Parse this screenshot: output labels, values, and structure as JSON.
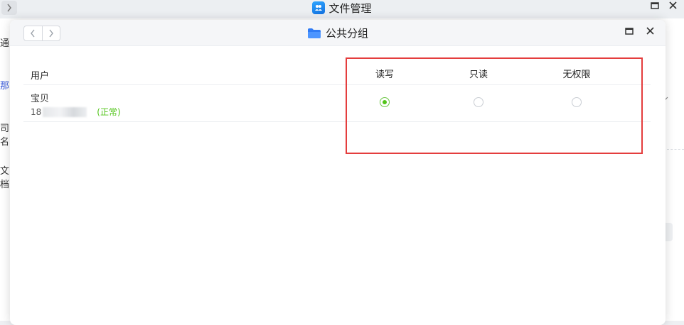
{
  "parent_window": {
    "title": "文件管理",
    "sidebar_fragments": [
      "通",
      "那",
      "司名",
      "文档"
    ]
  },
  "dialog": {
    "title": "公共分组",
    "table": {
      "columns": {
        "user": "用户",
        "read_write": "读写",
        "read_only": "只读",
        "no_access": "无权限"
      },
      "rows": [
        {
          "name": "宝贝",
          "phone_prefix": "18",
          "status": "(正常)",
          "permission": "read_write"
        }
      ]
    }
  },
  "colors": {
    "accent_green": "#52c41a",
    "annotation_red": "#e43d3d",
    "folder_blue": "#2f7bf5"
  }
}
